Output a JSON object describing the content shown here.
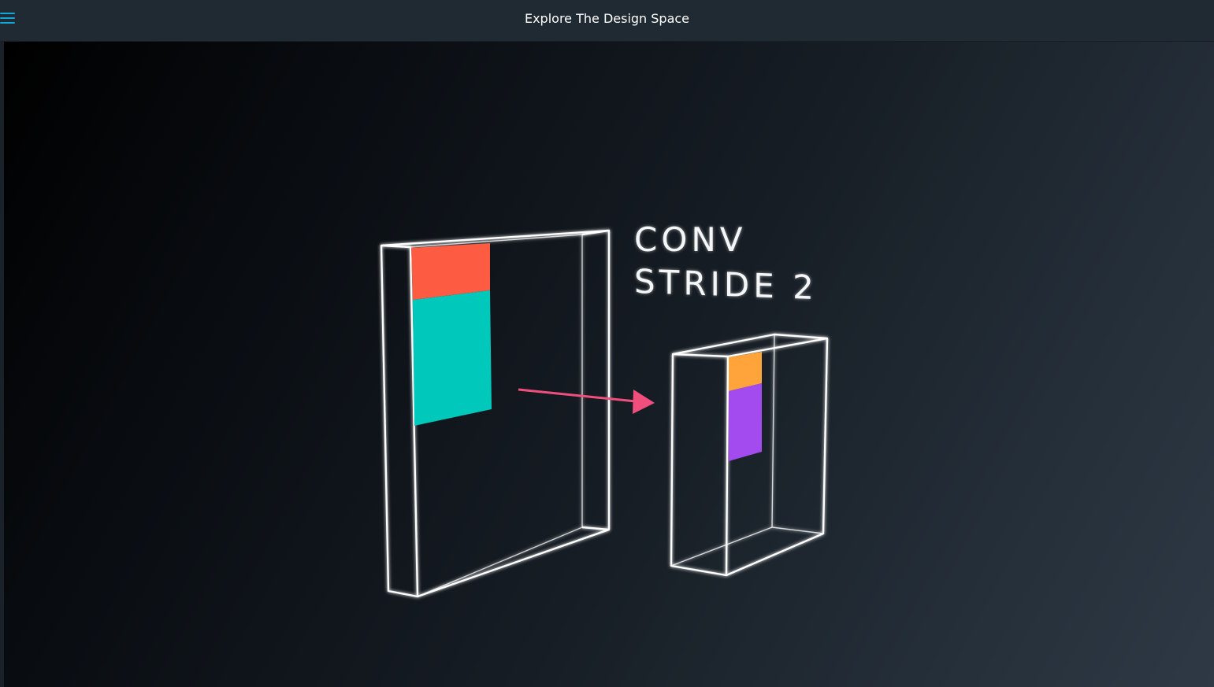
{
  "header": {
    "title": "Explore The Design Space",
    "menu_icon": "hamburger-menu-icon"
  },
  "video_frame": {
    "label_line1": "CONV",
    "label_line2": "STRIDE 2"
  },
  "colors": {
    "accent_menu": "#11a7d8",
    "filter_orange_red": "#fd5c42",
    "filter_teal": "#00c8bb",
    "output_orange": "#fea43a",
    "output_purple": "#a44bf0",
    "arrow_pink": "#f04e7c"
  }
}
